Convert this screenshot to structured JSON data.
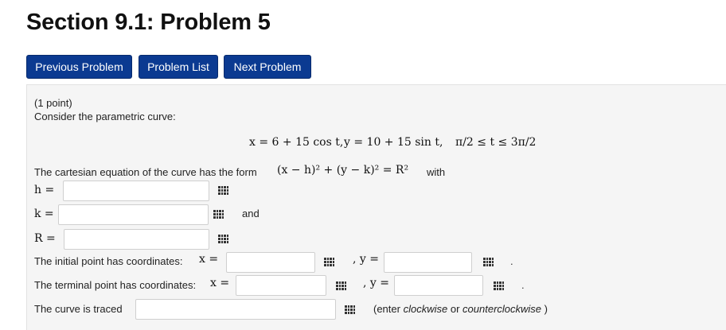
{
  "page": {
    "title": "Section 9.1: Problem 5"
  },
  "nav": {
    "previous": "Previous Problem",
    "list": "Problem List",
    "next": "Next Problem"
  },
  "problem": {
    "points": "(1 point)",
    "intro": "Consider the parametric curve:",
    "equation": {
      "x_part": "x = 6 + 15 cos t,",
      "y_part": "y = 10 + 15 sin t,",
      "range": "π/2 ≤ t ≤ 3π/2"
    },
    "cartesian_prefix": "The cartesian equation of the curve has the form",
    "cartesian_form": "(x − h)² + (y − k)² = R²",
    "cartesian_suffix": "with",
    "h_label": "h =",
    "k_label": "k =",
    "and_text": "and",
    "R_label": "R =",
    "initial_label": "The initial point has coordinates:",
    "terminal_label": "The terminal point has coordinates:",
    "x_eq": "x =",
    "y_eq": ", y =",
    "period": ".",
    "traced_label": "The curve is traced",
    "traced_hint_open": "(enter",
    "traced_hint_cw": "clockwise",
    "traced_hint_or": "or",
    "traced_hint_ccw": "counterclockwise",
    "traced_hint_close": ")"
  },
  "answers": {
    "h": "",
    "k": "",
    "R": "",
    "initial_x": "",
    "initial_y": "",
    "terminal_x": "",
    "terminal_y": "",
    "direction": ""
  }
}
